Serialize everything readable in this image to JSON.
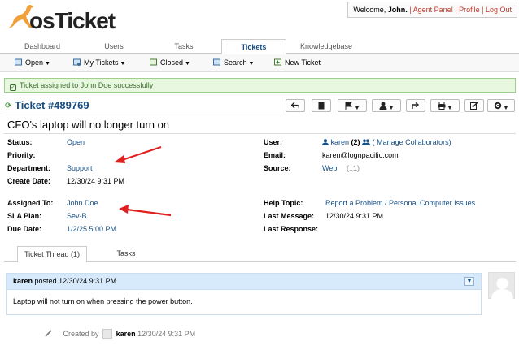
{
  "header": {
    "logo_text": "osTicket",
    "welcome_prefix": "Welcome,",
    "user_name": "John.",
    "links": [
      "Agent Panel",
      "Profile",
      "Log Out"
    ]
  },
  "nav": {
    "tabs": [
      "Dashboard",
      "Users",
      "Tasks",
      "Tickets",
      "Knowledgebase"
    ],
    "active": "Tickets"
  },
  "subnav": {
    "items": [
      "Open",
      "My Tickets",
      "Closed",
      "Search",
      "New Ticket"
    ]
  },
  "alert": {
    "message": "Ticket assigned to John Doe successfully"
  },
  "ticket": {
    "number": "Ticket #489769",
    "subject": "CFO's laptop will no longer turn on"
  },
  "fields_left_1": [
    {
      "label": "Status:",
      "value": "Open"
    },
    {
      "label": "Priority:",
      "value": ""
    },
    {
      "label": "Department:",
      "value": "Support"
    },
    {
      "label": "Create Date:",
      "value": "12/30/24 9:31 PM"
    }
  ],
  "fields_right_1": [
    {
      "label": "User:",
      "value": "karen",
      "count": "(2)",
      "extra": "( Manage Collaborators)"
    },
    {
      "label": "Email:",
      "value": "karen@lognpacific.com"
    },
    {
      "label": "Source:",
      "value": "Web",
      "extra": "(::1)"
    }
  ],
  "fields_left_2": [
    {
      "label": "Assigned To:",
      "value": "John Doe"
    },
    {
      "label": "SLA Plan:",
      "value": "Sev-B"
    },
    {
      "label": "Due Date:",
      "value": "1/2/25 5:00 PM"
    }
  ],
  "fields_right_2": [
    {
      "label": "Help Topic:",
      "value": "Report a Problem / Personal Computer Issues"
    },
    {
      "label": "Last Message:",
      "value": "12/30/24 9:31 PM"
    },
    {
      "label": "Last Response:",
      "value": ""
    }
  ],
  "detail_tabs": [
    "Ticket Thread (1)",
    "Tasks"
  ],
  "thread": {
    "author": "karen",
    "posted": "posted",
    "date": "12/30/24 9:31 PM",
    "body": "Laptop will not turn on when pressing the power button."
  },
  "created": {
    "prefix": "Created by",
    "author": "karen",
    "date": "12/30/24 9:31 PM"
  },
  "colors": {
    "link": "#184E81",
    "alert_bg": "#e8f7e0",
    "thread_head_bg": "#d6eafc",
    "arrow": "#e02020"
  }
}
